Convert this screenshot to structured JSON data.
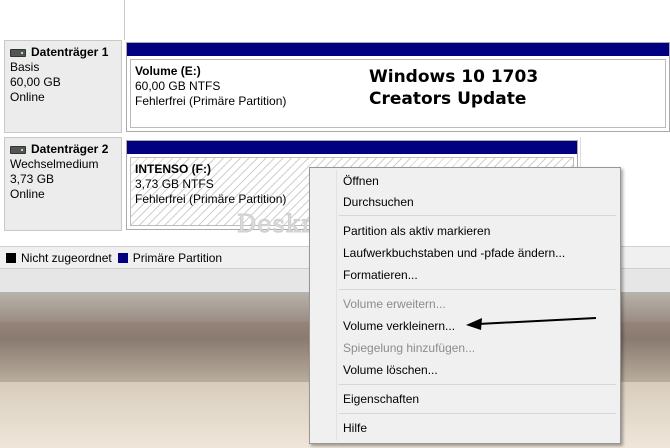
{
  "disks": [
    {
      "name": "Datenträger 1",
      "type": "Basis",
      "size": "60,00 GB",
      "status": "Online",
      "partition": {
        "label": "Volume  (E:)",
        "size_fs": "60,00 GB NTFS",
        "state": "Fehlerfrei (Primäre Partition)"
      }
    },
    {
      "name": "Datenträger 2",
      "type": "Wechselmedium",
      "size": "3,73 GB",
      "status": "Online",
      "partition": {
        "label": "INTENSO  (F:)",
        "size_fs": "3,73 GB NTFS",
        "state": "Fehlerfrei (Primäre Partition)"
      }
    }
  ],
  "overlay": {
    "line1": "Windows 10 1703",
    "line2": "Creators Update"
  },
  "watermark": "Deskmodder.de",
  "legend": [
    {
      "label": "Nicht zugeordnet",
      "color": "#000000"
    },
    {
      "label": "Primäre Partition",
      "color": "#000080"
    }
  ],
  "context_menu": {
    "items": [
      {
        "label": "Öffnen",
        "disabled": false
      },
      {
        "label": "Durchsuchen",
        "disabled": false
      },
      {
        "label": "Partition als aktiv markieren",
        "disabled": false
      },
      {
        "label": "Laufwerkbuchstaben und -pfade ändern...",
        "disabled": false
      },
      {
        "label": "Formatieren...",
        "disabled": false
      },
      {
        "label": "Volume erweitern...",
        "disabled": true
      },
      {
        "label": "Volume verkleinern...",
        "disabled": false
      },
      {
        "label": "Spiegelung hinzufügen...",
        "disabled": true
      },
      {
        "label": "Volume löschen...",
        "disabled": false
      },
      {
        "label": "Eigenschaften",
        "disabled": false
      },
      {
        "label": "Hilfe",
        "disabled": false
      }
    ]
  },
  "colors": {
    "partition_bar": "#000080",
    "menu_background": "#f0f0f0",
    "disabled_text": "#8c8c8c"
  }
}
